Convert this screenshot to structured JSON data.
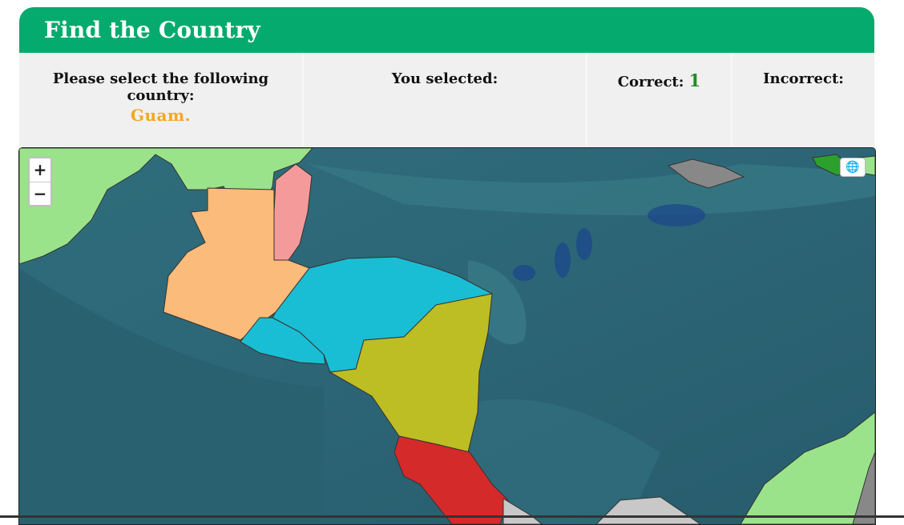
{
  "header": {
    "title": "Find the Country"
  },
  "stats": {
    "prompt_label": "Please select the following country:",
    "target_country": "Guam.",
    "selected_label": "You selected:",
    "selected_value": "",
    "correct_label": "Correct:",
    "correct_value": "1",
    "incorrect_label": "Incorrect:",
    "incorrect_value": ""
  },
  "map_controls": {
    "zoom_in": "+",
    "zoom_out": "−",
    "layer_icon": "globe-icon"
  },
  "colors": {
    "header_bg": "#05ab6e",
    "target_text": "#f5a623",
    "correct_text": "#1c8f21",
    "ocean": "#2e6876",
    "land_default": "#9ae38a",
    "guatemala": "#fbbb7a",
    "belize": "#f59a9a",
    "honduras": "#1abed4",
    "el_salvador": "#1abed4",
    "nicaragua": "#bdbd24",
    "costa_rica": "#d42a2a",
    "jamaica": "#888888",
    "haiti": "#2ca02c"
  }
}
